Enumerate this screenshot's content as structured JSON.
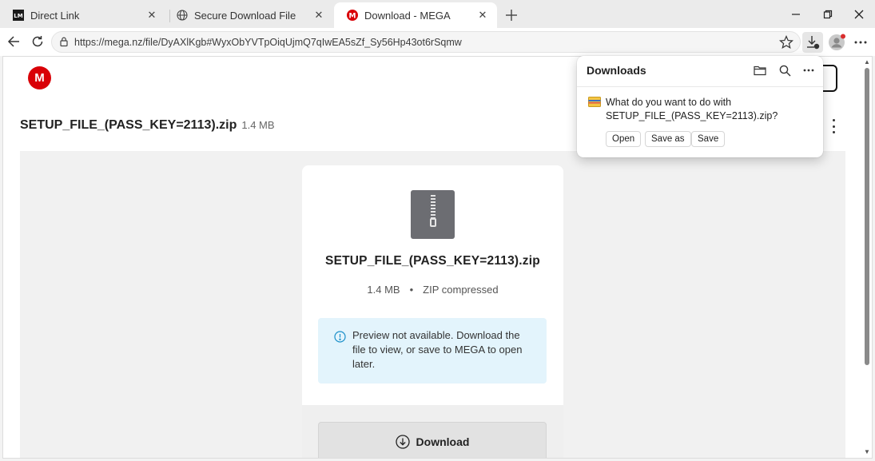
{
  "tabs": [
    {
      "title": "Direct Link",
      "favicon": "lm-logo-icon"
    },
    {
      "title": "Secure Download File",
      "favicon": "globe-icon"
    },
    {
      "title": "Download - MEGA",
      "favicon": "mega-icon",
      "active": true
    }
  ],
  "address_bar": {
    "url": "https://mega.nz/file/DyAXlKgb#WyxObYVTpOiqUjmQ7qIwEA5sZf_Sy56Hp43ot6rSqmw"
  },
  "page": {
    "logo_letter": "M",
    "file_name": "SETUP_FILE_(PASS_KEY=2113).zip",
    "file_size": "1.4 MB",
    "card": {
      "file_name": "SETUP_FILE_(PASS_KEY=2113).zip",
      "size": "1.4 MB",
      "separator": "•",
      "type": "ZIP compressed",
      "notice": "Preview not available. Download the file to view, or save to MEGA to open later.",
      "download_label": "Download"
    }
  },
  "downloads_flyout": {
    "title": "Downloads",
    "question_prefix": "What do you want to do with",
    "file_name": "SETUP_FILE_(PASS_KEY=2113).zip?",
    "actions": {
      "open": "Open",
      "save_as": "Save as",
      "save": "Save"
    }
  },
  "colors": {
    "mega_red": "#d90007",
    "notice_bg": "#e3f4fc",
    "info_blue": "#1a8fc9"
  }
}
